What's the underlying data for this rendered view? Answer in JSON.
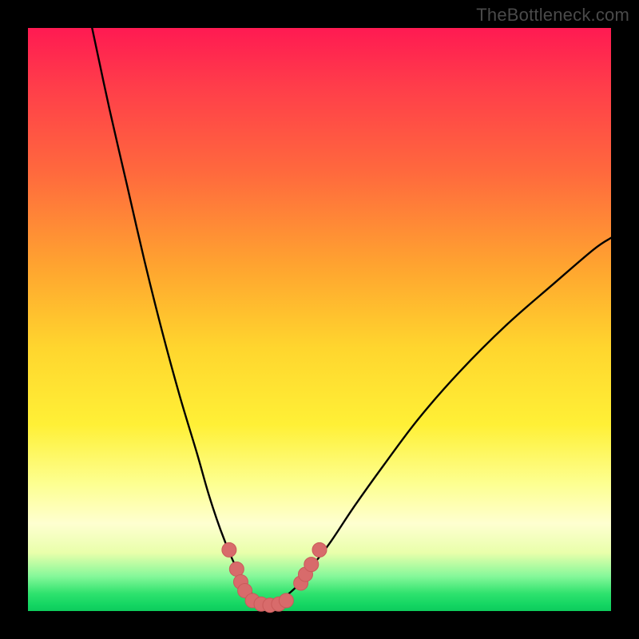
{
  "watermark": "TheBottleneck.com",
  "colors": {
    "background": "#000000",
    "gradient_top": "#ff1a52",
    "gradient_mid1": "#ffa82f",
    "gradient_mid2": "#fff036",
    "gradient_pale": "#feffd0",
    "gradient_green": "#13d562",
    "curve_stroke": "#000000",
    "marker_fill": "#d86b6b",
    "marker_stroke": "#c95a5a"
  },
  "chart_data": {
    "type": "line",
    "title": "",
    "xlabel": "",
    "ylabel": "",
    "xlim": [
      0,
      100
    ],
    "ylim": [
      0,
      100
    ],
    "grid": false,
    "legend": false,
    "note": "Bottleneck-style V-curve. Two branches descend from top-left and top-right toward a rounded minimum near x≈41. Values below are estimated pixel-to-axis readings (no axis ticks present in source). y≈0 is the green floor, y≈100 is the top.",
    "series": [
      {
        "name": "left-branch",
        "x": [
          11,
          14,
          17,
          20,
          23,
          26,
          29,
          31,
          33,
          35,
          36.5,
          38,
          39.5,
          41
        ],
        "y": [
          100,
          86,
          73,
          60,
          48,
          37,
          27,
          20,
          14,
          9,
          6,
          3.5,
          1.8,
          1
        ]
      },
      {
        "name": "right-branch",
        "x": [
          41,
          43,
          45,
          47,
          49,
          52,
          56,
          61,
          67,
          74,
          82,
          90,
          97,
          100
        ],
        "y": [
          1,
          1.8,
          3.2,
          5.2,
          8,
          12,
          18,
          25,
          33,
          41,
          49,
          56,
          62,
          64
        ]
      }
    ],
    "markers": {
      "name": "highlighted-points",
      "note": "Salmon-colored rounded markers clustered near the curve minimum; some overlap forming short pill shapes.",
      "points": [
        {
          "x": 34.5,
          "y": 10.5
        },
        {
          "x": 35.8,
          "y": 7.2
        },
        {
          "x": 36.5,
          "y": 5.0
        },
        {
          "x": 37.2,
          "y": 3.5
        },
        {
          "x": 38.5,
          "y": 1.8
        },
        {
          "x": 40.0,
          "y": 1.2
        },
        {
          "x": 41.5,
          "y": 1.0
        },
        {
          "x": 43.0,
          "y": 1.2
        },
        {
          "x": 44.3,
          "y": 1.8
        },
        {
          "x": 46.8,
          "y": 4.8
        },
        {
          "x": 47.6,
          "y": 6.3
        },
        {
          "x": 48.6,
          "y": 8.0
        },
        {
          "x": 50.0,
          "y": 10.5
        }
      ]
    }
  }
}
